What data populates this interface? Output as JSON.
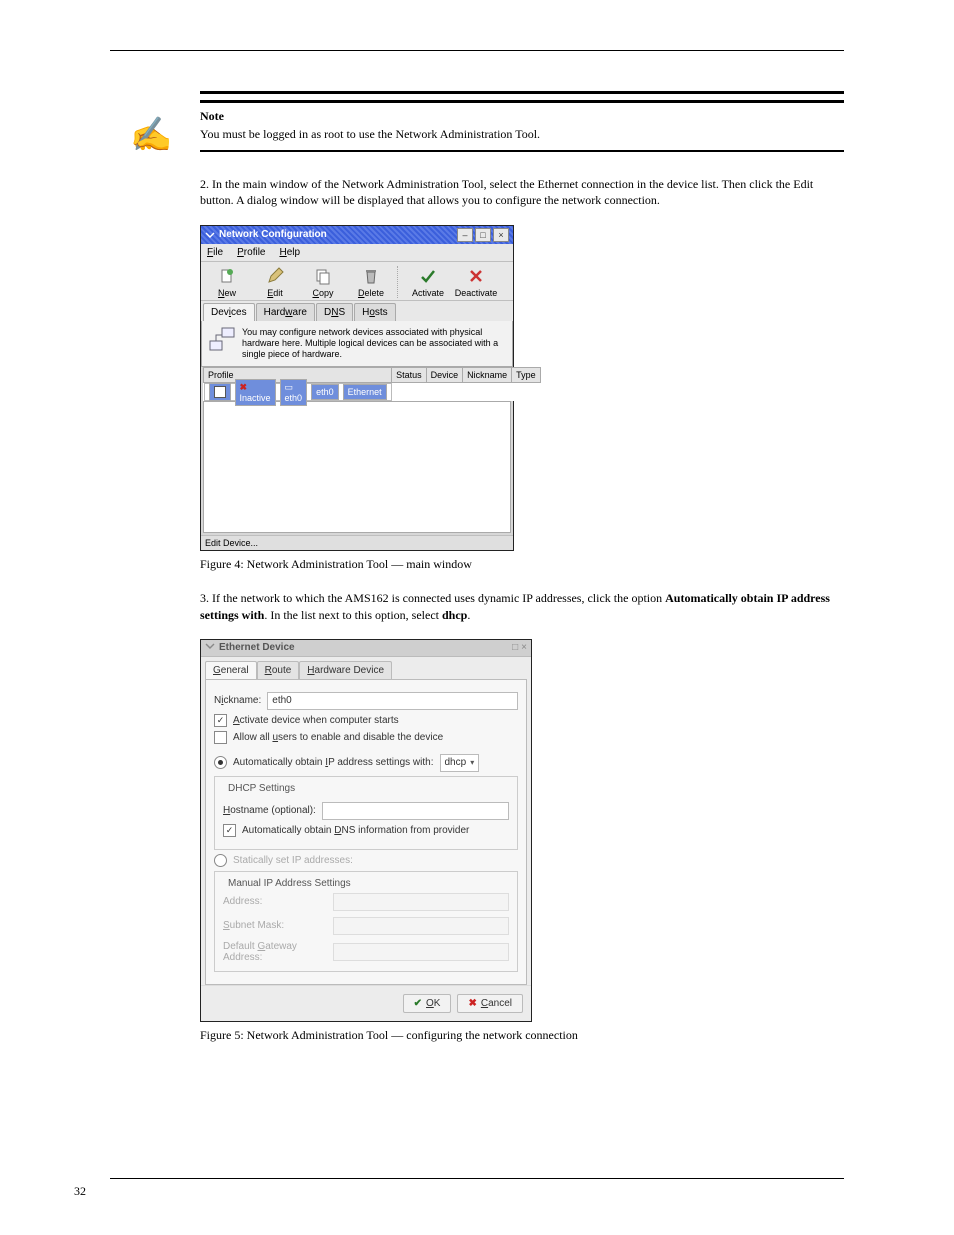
{
  "page": {
    "number": "32",
    "note": {
      "label": "Note",
      "text": "You must be logged in as root to use the Network Administration Tool."
    },
    "para1a": "2.",
    "para1b": "In the main window of the Network Administration Tool, select the Ethernet connection in the device list. Then click the Edit button. A dialog window will be displayed that allows you to configure the network connection.",
    "para2a": "3.",
    "para2b": "If the network to which the AMS162 is connected uses dynamic IP addresses, click the option Automatically obtain IP address settings with. In the list next to this option, select dhcp.",
    "fig1_caption": "Figure 4: Network Administration Tool — main window",
    "fig2_caption": "Figure 5: Network Administration Tool — configuring the network connection"
  },
  "win1": {
    "title": "Network Configuration",
    "menu": {
      "file": "File",
      "profile": "Profile",
      "help": "Help"
    },
    "toolbar": {
      "new": "New",
      "edit": "Edit",
      "copy": "Copy",
      "delete": "Delete",
      "activate": "Activate",
      "deactivate": "Deactivate"
    },
    "tabs": {
      "devices": "Devices",
      "hardware": "Hardware",
      "dns": "DNS",
      "hosts": "Hosts"
    },
    "info": "You may configure network devices associated with physical hardware here.  Multiple logical devices can be associated with a single piece of hardware.",
    "headers": {
      "profile": "Profile",
      "status": "Status",
      "device": "Device",
      "nickname": "Nickname",
      "type": "Type"
    },
    "row": {
      "status": "Inactive",
      "device": "eth0",
      "nickname": "eth0",
      "type": "Ethernet"
    },
    "statusbar": "Edit Device..."
  },
  "win2": {
    "title": "Ethernet Device",
    "tabs": {
      "general": "General",
      "route": "Route",
      "hardware": "Hardware Device"
    },
    "nickname_label": "Nickname:",
    "nickname_value": "eth0",
    "activate_label": "Activate device when computer starts",
    "allow_label": "Allow all users to enable and disable the device",
    "auto_ip_label": "Automatically obtain IP address settings with:",
    "auto_ip_method": "dhcp",
    "dhcp_legend": "DHCP Settings",
    "hostname_label": "Hostname (optional):",
    "auto_dns_label": "Automatically obtain DNS information from provider",
    "static_label": "Statically set IP addresses:",
    "manual_legend": "Manual IP Address Settings",
    "addr_label": "Address:",
    "mask_label": "Subnet Mask:",
    "gw_label": "Default Gateway Address:",
    "ok": "OK",
    "cancel": "Cancel"
  }
}
